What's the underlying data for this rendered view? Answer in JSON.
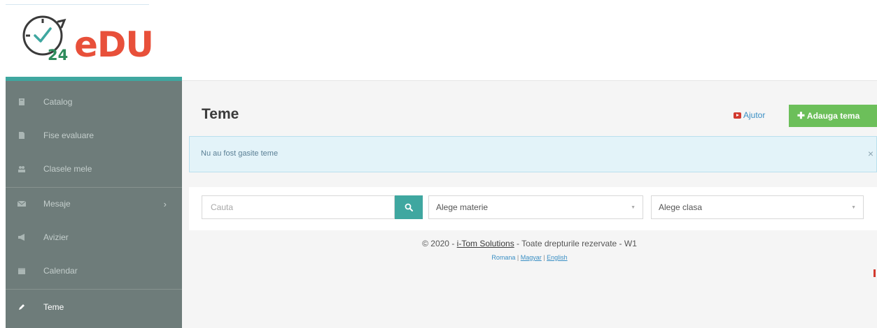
{
  "logo": {
    "number": "24",
    "word": "eDU"
  },
  "sidebar": {
    "items": [
      {
        "label": "Catalog",
        "icon": "book-icon"
      },
      {
        "label": "Fise evaluare",
        "icon": "file-icon"
      },
      {
        "label": "Clasele mele",
        "icon": "group-icon"
      },
      {
        "label": "Mesaje",
        "icon": "envelope-icon",
        "chevron": "›"
      },
      {
        "label": "Avizier",
        "icon": "bullhorn-icon"
      },
      {
        "label": "Calendar",
        "icon": "calendar-icon"
      },
      {
        "label": "Teme",
        "icon": "pencil-icon",
        "active": true
      }
    ]
  },
  "main": {
    "title": "Teme",
    "help_label": "Ajutor",
    "add_label": "Adauga tema",
    "alert": {
      "text": "Nu au fost gasite teme",
      "close": "×"
    }
  },
  "filters": {
    "search_placeholder": "Cauta",
    "subject_select": "Alege materie",
    "class_select": "Alege clasa"
  },
  "footer": {
    "prefix": "© 2020 - ",
    "company": "i-Tom Solutions",
    "suffix": " - Toate drepturile rezervate - W1",
    "langs": [
      "Romana",
      "Magyar",
      "English"
    ]
  },
  "colors": {
    "sidebar_bg": "#6e7c7a",
    "accent": "#3fa7a0",
    "add_button": "#6cbf5a",
    "alert_bg": "#e3f3f9",
    "logo_red": "#e8503a"
  }
}
